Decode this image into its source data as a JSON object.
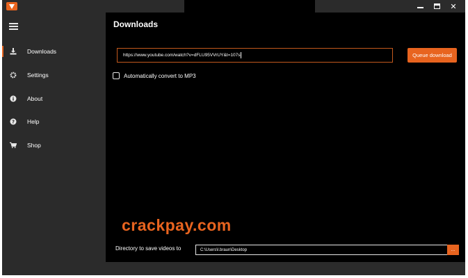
{
  "sidebar": {
    "items": [
      {
        "label": "Downloads",
        "icon": "download-icon"
      },
      {
        "label": "Settings",
        "icon": "gear-icon"
      },
      {
        "label": "About",
        "icon": "info-icon"
      },
      {
        "label": "Help",
        "icon": "help-icon"
      },
      {
        "label": "Shop",
        "icon": "cart-icon"
      }
    ],
    "active_index": 0
  },
  "main": {
    "title": "Downloads",
    "url_input_value": "https://www.youtube.com/watch?v=dFLU95VVrUY&t=107s",
    "queue_button_label": "Queue download",
    "convert_mp3_label": "Automatically convert to MP3",
    "convert_mp3_checked": false,
    "watermark": "crackpay.com",
    "directory_label": "Directory to save videos to",
    "directory_value": "C:\\Users\\l.braun\\Desktop",
    "browse_button_label": "..."
  },
  "colors": {
    "accent": "#e8641f",
    "background": "#000000",
    "sidebar": "#2b2b2b"
  }
}
